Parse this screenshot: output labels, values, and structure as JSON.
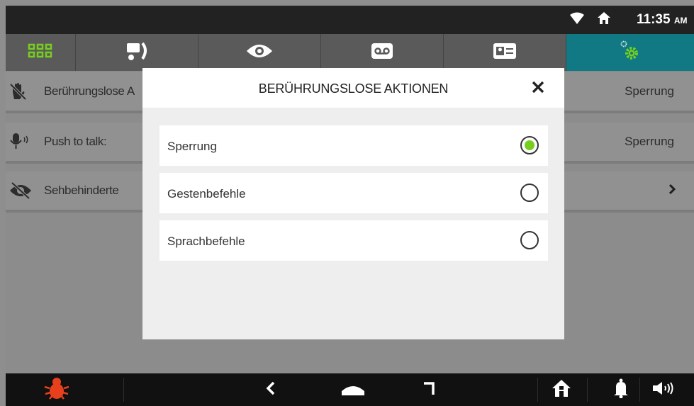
{
  "status_bar": {
    "time": "11:35",
    "ampm": "AM"
  },
  "tabs": [
    {
      "icon": "grid-apps-icon"
    },
    {
      "icon": "intercom-handset-icon"
    },
    {
      "icon": "eye-icon"
    },
    {
      "icon": "voicemail-icon"
    },
    {
      "icon": "contact-card-icon"
    },
    {
      "icon": "settings-gears-icon",
      "active": true
    }
  ],
  "settings": {
    "rows": [
      {
        "label": "Berührungslose A",
        "value": "Sperrung"
      },
      {
        "label": "Push to talk:",
        "value": "Sperrung"
      },
      {
        "label": "Sehbehinderte"
      }
    ]
  },
  "modal": {
    "title": "BERÜHRUNGSLOSE AKTIONEN",
    "options": [
      {
        "label": "Sperrung",
        "selected": true
      },
      {
        "label": "Gestenbefehle",
        "selected": false
      },
      {
        "label": "Sprachbefehle",
        "selected": false
      }
    ]
  },
  "colors": {
    "accent_teal": "#107983",
    "tab_icon_green": "#76cf1e",
    "radio_selected": "#76cf1e",
    "alarm_red": "#e8401c"
  },
  "nav_bar": {
    "icons": [
      "alarm-bug-icon",
      "back-icon",
      "home-icon",
      "recent-apps-icon",
      "home-house-icon",
      "bell-icon",
      "volume-icon"
    ]
  }
}
